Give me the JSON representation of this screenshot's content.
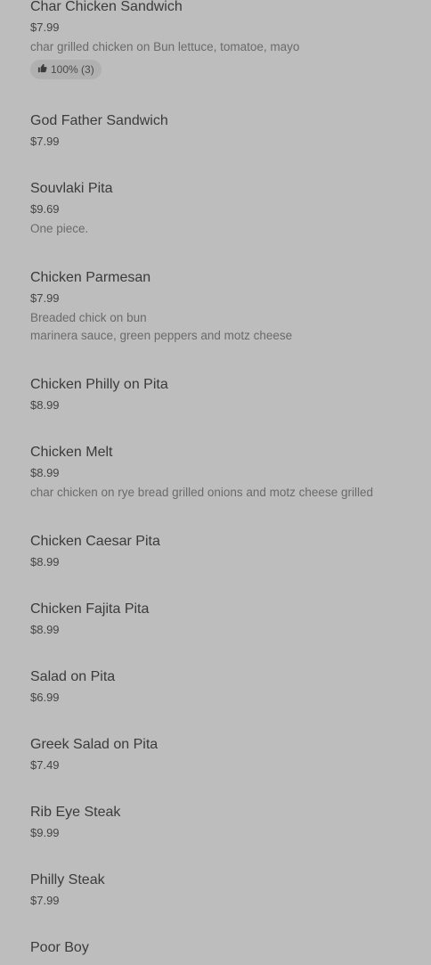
{
  "items": [
    {
      "name": "Char Chicken Sandwich",
      "price": "$7.99",
      "desc": [
        "char grilled chicken on Bun lettuce, tomatoe, mayo"
      ],
      "rating": "100% (3)"
    },
    {
      "name": "God Father Sandwich",
      "price": "$7.99",
      "desc": []
    },
    {
      "name": "Souvlaki Pita",
      "price": "$9.69",
      "desc": [
        "One piece."
      ]
    },
    {
      "name": "Chicken Parmesan",
      "price": "$7.99",
      "desc": [
        "Breaded chick on bun",
        "marinera sauce, green peppers and motz cheese"
      ]
    },
    {
      "name": "Chicken Philly on Pita",
      "price": "$8.99",
      "desc": []
    },
    {
      "name": "Chicken Melt",
      "price": "$8.99",
      "desc": [
        "char chicken on rye bread grilled onions and motz cheese grilled"
      ]
    },
    {
      "name": "Chicken Caesar Pita",
      "price": "$8.99",
      "desc": []
    },
    {
      "name": "Chicken Fajita Pita",
      "price": "$8.99",
      "desc": []
    },
    {
      "name": "Salad on Pita",
      "price": "$6.99",
      "desc": []
    },
    {
      "name": "Greek Salad on Pita",
      "price": "$7.49",
      "desc": []
    },
    {
      "name": "Rib Eye Steak",
      "price": "$9.99",
      "desc": []
    },
    {
      "name": "Philly Steak",
      "price": "$7.99",
      "desc": []
    },
    {
      "name": "Poor Boy",
      "price": "",
      "desc": []
    }
  ]
}
